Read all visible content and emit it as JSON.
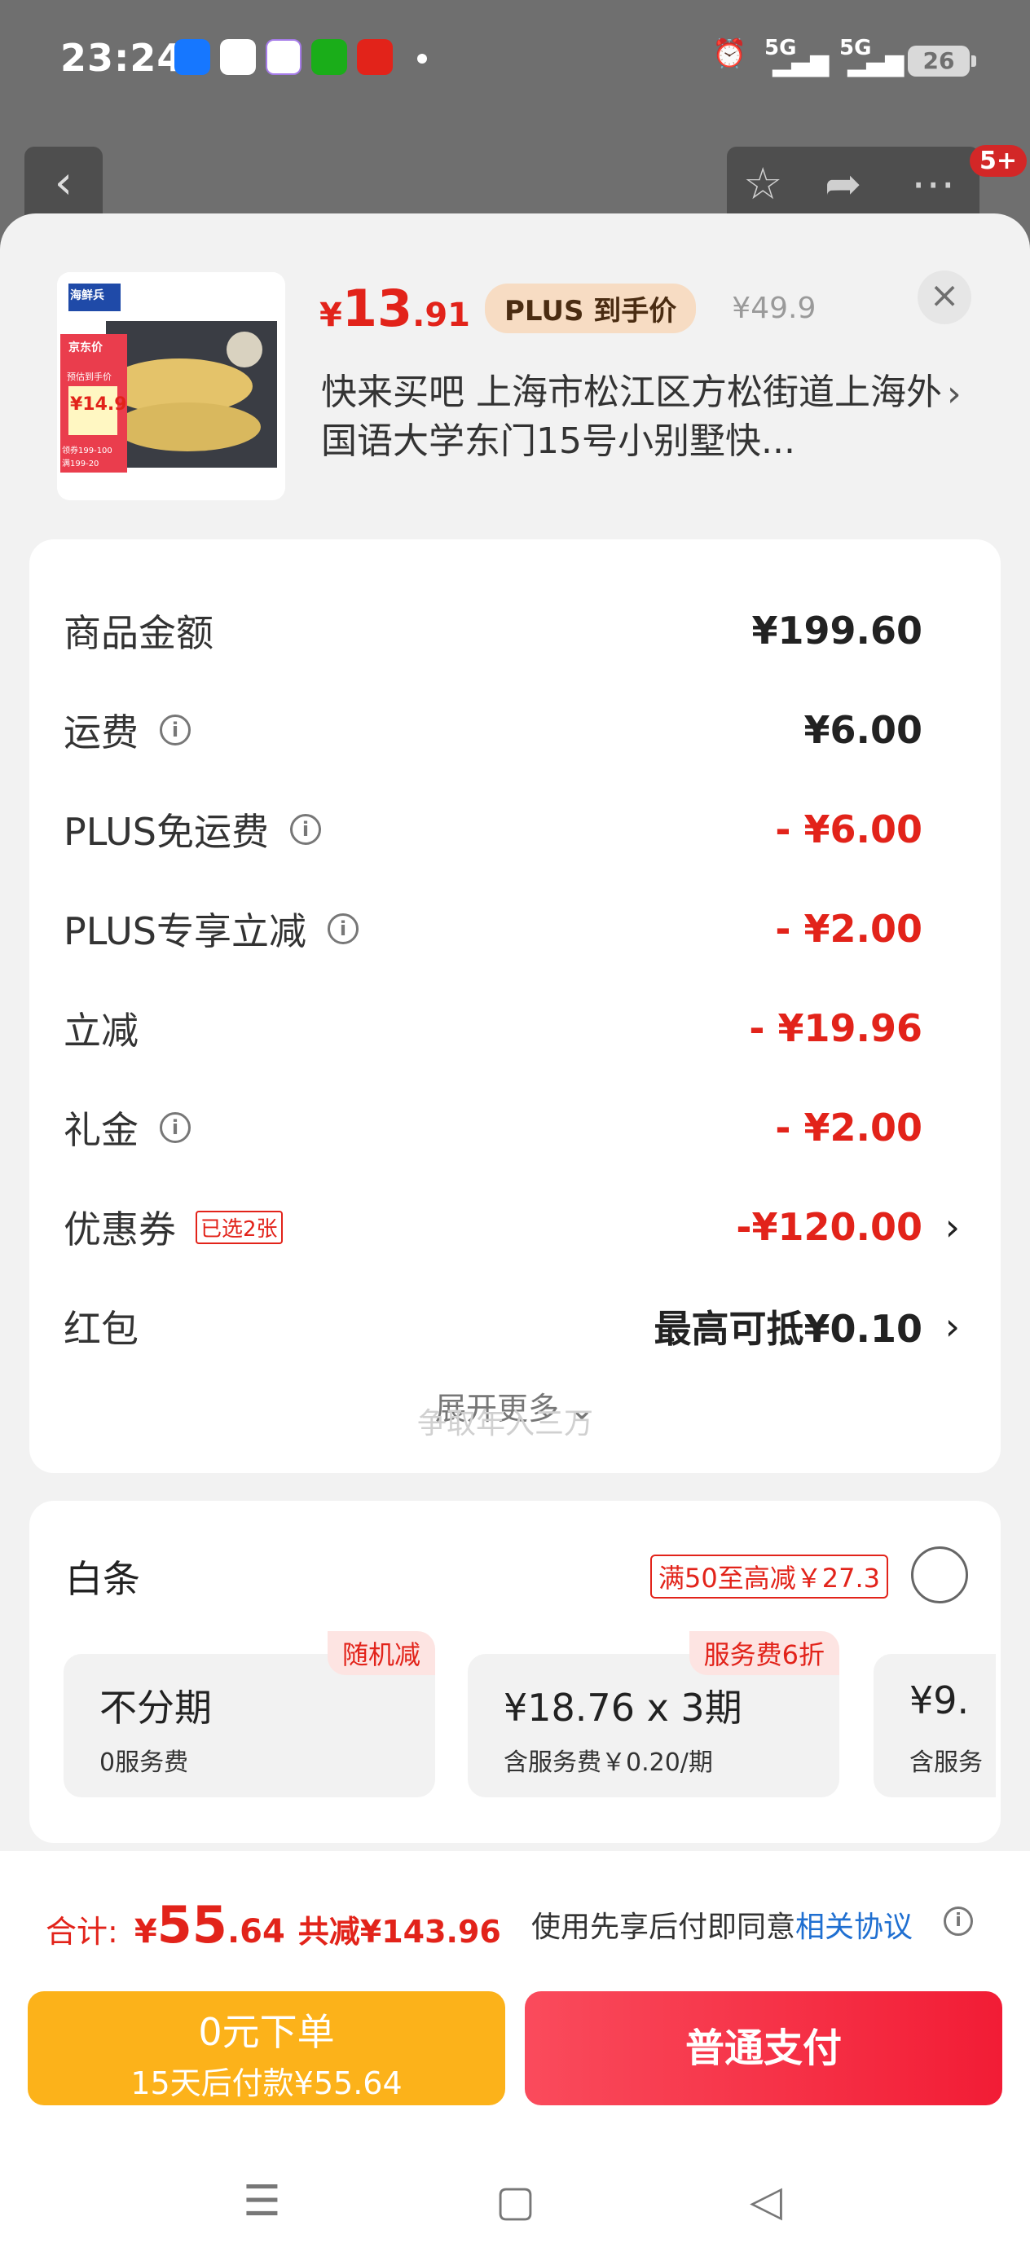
{
  "status_bar": {
    "time": "23:24",
    "signal1": "5G",
    "signal2": "5G",
    "battery": "26"
  },
  "top_bar": {
    "notification": "5+"
  },
  "product": {
    "price_symbol": "¥",
    "price_int": "13",
    "price_dec": ".91",
    "plus_label": "PLUS 到手价",
    "original_price": "¥49.9",
    "address": "快来买吧 上海市松江区方松街道上海外国语大学东门15号小别墅快...",
    "img_brand": "海鲜兵",
    "img_jd": "京东价",
    "img_price_label": "预估到手价",
    "img_price": "¥14.9",
    "img_coupon1": "领券199-100",
    "img_coupon2": "满199-20"
  },
  "cost_rows": [
    {
      "label": "商品金额",
      "value": "¥199.60"
    },
    {
      "label": "运费",
      "value": "¥6.00"
    },
    {
      "label": "PLUS免运费",
      "value": "- ¥6.00"
    },
    {
      "label": "PLUS专享立减",
      "value": "- ¥2.00"
    },
    {
      "label": "立减",
      "value": "- ¥19.96"
    },
    {
      "label": "礼金",
      "value": "- ¥2.00"
    },
    {
      "label": "优惠券",
      "chip": "已选2张",
      "value": "-¥120.00"
    },
    {
      "label": "红包",
      "value": "最高可抵¥0.10"
    }
  ],
  "expand_more": "展开更多",
  "watermark": "争取年入三万",
  "baitiao": {
    "title": "白条",
    "promo": "满50至高减￥27.3",
    "options": [
      {
        "title": "不分期",
        "sub": "0服务费",
        "badge": "随机减"
      },
      {
        "title": "¥18.76 x 3期",
        "sub": "含服务费￥0.20/期",
        "badge": "服务费6折"
      },
      {
        "title": "¥9.",
        "sub": "含服务"
      }
    ]
  },
  "bottom": {
    "total_label": "合计:",
    "total_symbol": "¥",
    "total_int": "55",
    "total_dec": ".64",
    "total_reduce": "共减¥143.96",
    "agree_text": "使用先享后付即同意",
    "agree_link": "相关协议",
    "btn_zero": "0元下单",
    "btn_zero_sub": "15天后付款¥55.64",
    "btn_pay": "普通支付"
  },
  "colors": {
    "accent": "#e2231a",
    "plus_bg": "#f7dcc3",
    "zero_btn": "#fcb21a",
    "pay_btn": "#f21c35",
    "link": "#1f6fd1"
  }
}
